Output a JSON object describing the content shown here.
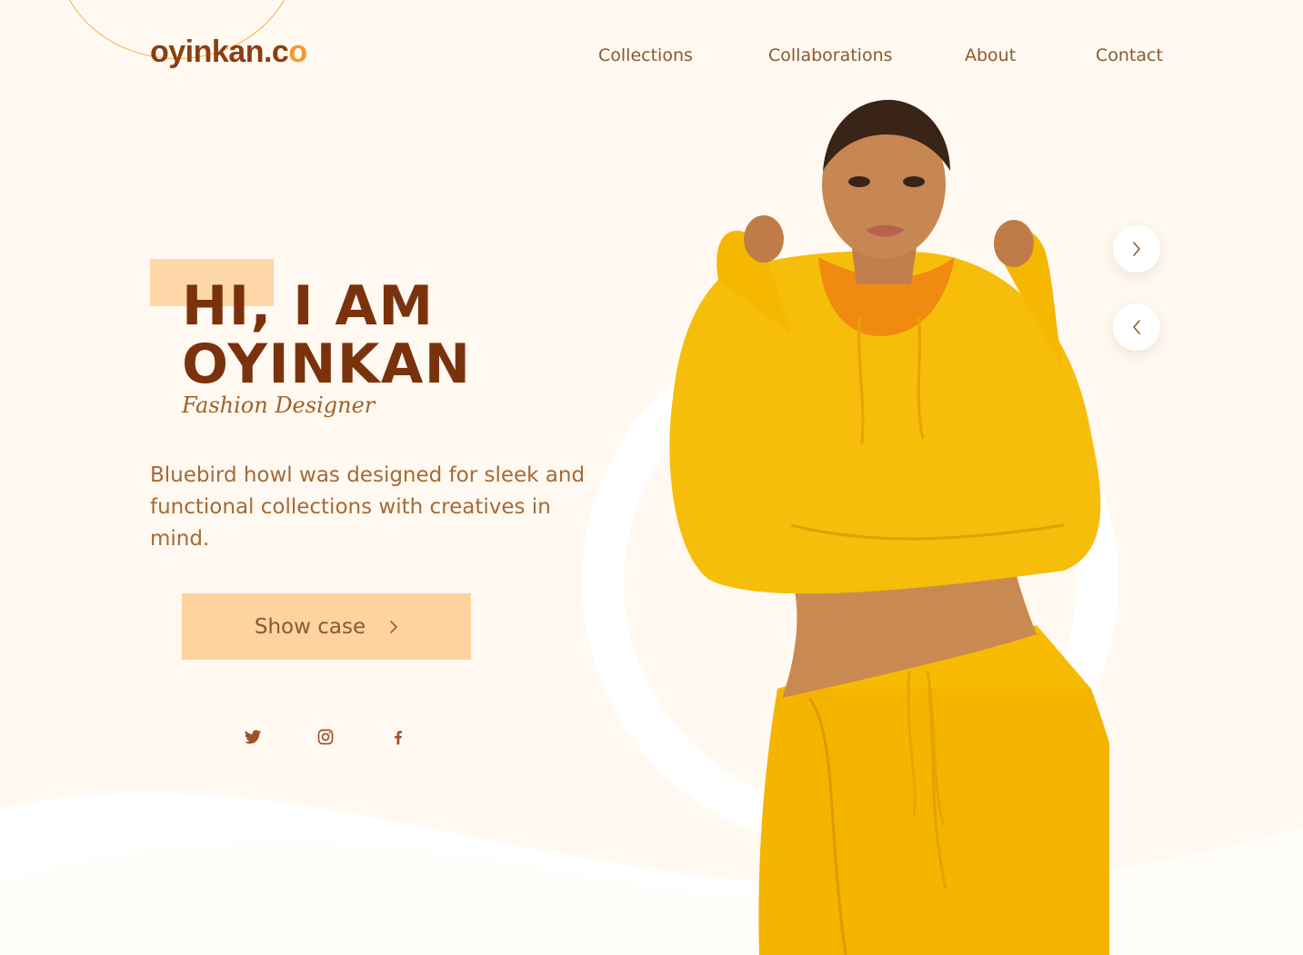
{
  "brand": {
    "logo_main": "oyinkan.c",
    "logo_accent": "o"
  },
  "nav": {
    "items": [
      "Collections",
      "Collaborations",
      "About",
      "Contact"
    ]
  },
  "hero": {
    "title_line1": "HI, I AM",
    "title_line2": "OYINKAN",
    "subtitle": "Fashion Designer",
    "description": "Bluebird howl was designed for sleek and functional collections with creatives in mind.",
    "cta_label": "Show case"
  },
  "icons": {
    "cta": "chevron-right-icon",
    "next": "chevron-right-icon",
    "prev": "chevron-left-icon",
    "socials": [
      "twitter-icon",
      "instagram-icon",
      "facebook-icon"
    ]
  },
  "colors": {
    "background": "#fff9f1",
    "brand_dark": "#7a320d",
    "accent": "#f29a2e",
    "cta_bg": "#ffd29f",
    "outfit": "#f5b800"
  }
}
